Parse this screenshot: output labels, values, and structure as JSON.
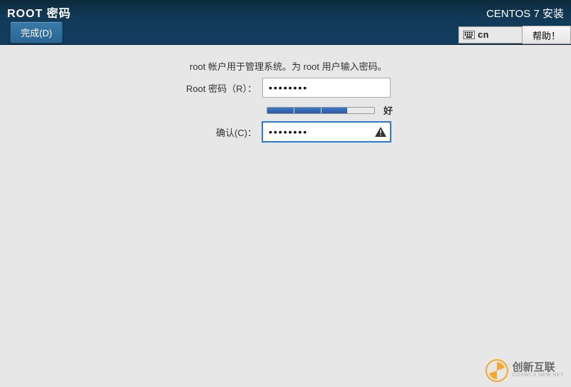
{
  "header": {
    "title": "ROOT 密码",
    "done_label": "完成(D)",
    "installer_title": "CENTOS 7 安装",
    "keyboard_layout": "cn",
    "help_label": "帮助！"
  },
  "form": {
    "description": "root 帐户用于管理系统。为 root 用户输入密码。",
    "password_label": "Root 密码（R）：",
    "password_value": "••••••••",
    "confirm_label": "确认(C)：",
    "confirm_value": "••••••••",
    "strength_label": "好"
  },
  "watermark": {
    "brand": "创新互联",
    "sub": "CDXWCX NEW NET"
  }
}
